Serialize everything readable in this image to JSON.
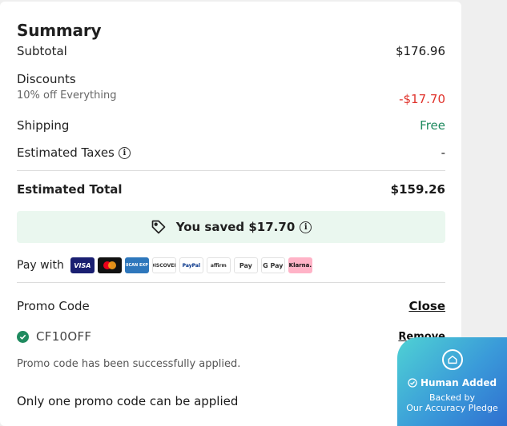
{
  "summary": {
    "title": "Summary",
    "subtotal_label": "Subtotal",
    "subtotal_value": "$176.96",
    "discounts_label": "Discounts",
    "discount_desc": "10% off Everything",
    "discount_value": "-$17.70",
    "shipping_label": "Shipping",
    "shipping_value": "Free",
    "taxes_label": "Estimated Taxes",
    "taxes_value": "-",
    "total_label": "Estimated Total",
    "total_value": "$159.26",
    "saved_text": "You saved $17.70"
  },
  "payment": {
    "label": "Pay with",
    "methods": [
      "VISA",
      "",
      "AMERICAN EXPRESS",
      "DISCOVER",
      "PayPal",
      "affirm",
      "Pay",
      "G Pay",
      "Klarna."
    ]
  },
  "promo": {
    "label": "Promo Code",
    "close_label": "Close",
    "code": "CF10OFF",
    "remove_label": "Remove",
    "success_msg": "Promo code has been successfully applied.",
    "note": "Only one promo code can be applied"
  },
  "badge": {
    "title": "Human Added",
    "subtitle_1": "Backed by",
    "subtitle_2": "Our Accuracy Pledge"
  },
  "colors": {
    "discount": "#e0322b",
    "free": "#1f8a5f",
    "saved_bg": "#eaf7ef"
  }
}
